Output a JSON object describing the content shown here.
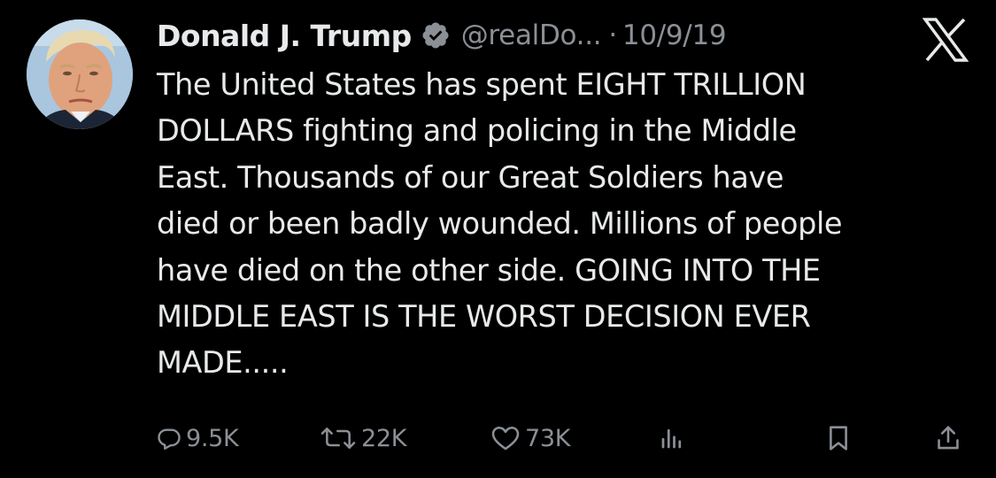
{
  "tweet": {
    "author": {
      "display_name": "Donald J. Trump",
      "handle": "@realDo...",
      "verified": true,
      "avatar_icon": "profile-photo"
    },
    "separator": "·",
    "date": "10/9/19",
    "platform_icon": "x-logo-icon",
    "text": "The United States has spent EIGHT TRILLION\nDOLLARS fighting and policing in the Middle\nEast. Thousands of our Great Soldiers have\ndied or been badly wounded. Millions of people\nhave died on the other side. GOING INTO THE\nMIDDLE EAST IS THE WORST DECISION EVER\nMADE.....",
    "actions": {
      "replies": "9.5K",
      "retweets": "22K",
      "likes": "73K"
    }
  },
  "colors": {
    "background": "#000000",
    "primary_text": "#e7e9ea",
    "secondary_text": "#8b9096"
  }
}
